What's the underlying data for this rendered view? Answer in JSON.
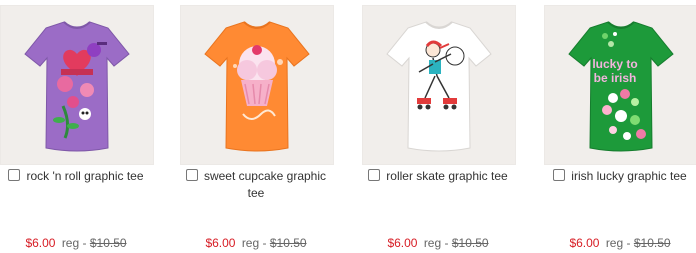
{
  "products": [
    {
      "name": "rock 'n roll graphic tee",
      "sale_price": "$6.00",
      "reg_label": "reg -",
      "reg_price": "$10.50",
      "shirt_color": "#9b6cc6",
      "icon": "rock-n-roll-tee-image"
    },
    {
      "name": "sweet cupcake graphic tee",
      "sale_price": "$6.00",
      "reg_label": "reg -",
      "reg_price": "$10.50",
      "shirt_color": "#ff8a33",
      "icon": "sweet-cupcake-tee-image"
    },
    {
      "name": "roller skate graphic tee",
      "sale_price": "$6.00",
      "reg_label": "reg -",
      "reg_price": "$10.50",
      "shirt_color": "#ffffff",
      "icon": "roller-skate-tee-image"
    },
    {
      "name": "irish lucky graphic tee",
      "sale_price": "$6.00",
      "reg_label": "reg -",
      "reg_price": "$10.50",
      "shirt_color": "#1d9a3a",
      "icon": "irish-lucky-tee-image"
    }
  ],
  "shirt_graphics": {
    "irish_text_line1": "lucky to",
    "irish_text_line2": "be irish"
  },
  "colors": {
    "sale_price": "#d71c24",
    "text": "#333333",
    "muted": "#666666"
  }
}
